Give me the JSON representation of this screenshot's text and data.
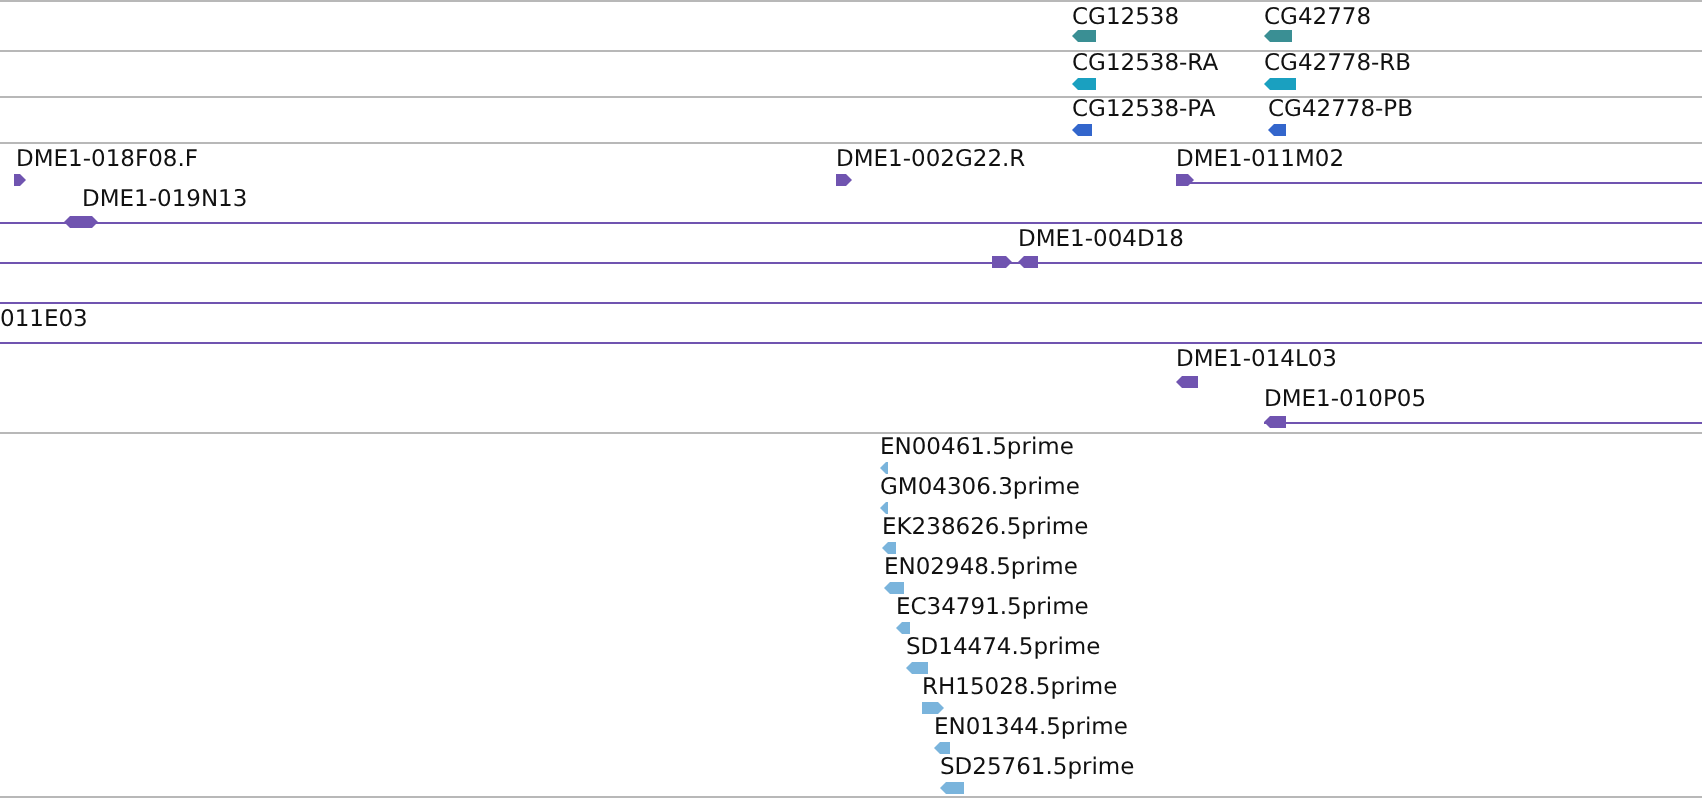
{
  "tracks": [
    {
      "features": [
        {
          "label": "CG12538",
          "kind": "reverse",
          "color": "#3a8f94"
        },
        {
          "label": "CG42778",
          "kind": "reverse",
          "color": "#3a8f94"
        }
      ]
    },
    {
      "features": [
        {
          "label": "CG12538-RA",
          "kind": "reverse",
          "color": "#1aa0c0"
        },
        {
          "label": "CG42778-RB",
          "kind": "reverse",
          "color": "#1aa0c0"
        }
      ]
    },
    {
      "features": [
        {
          "label": "CG12538-PA",
          "kind": "reverse",
          "color": "#3366cc"
        },
        {
          "label": "CG42778-PB",
          "kind": "reverse",
          "color": "#3366cc"
        }
      ]
    },
    {
      "features": [
        {
          "label": "DME1-018F08.F",
          "kind": "forward",
          "color": "#7054b0"
        },
        {
          "label": "DME1-019N13",
          "kind": "both",
          "color": "#7054b0"
        },
        {
          "label": "DME1-002G22.R",
          "kind": "forward",
          "color": "#7054b0"
        },
        {
          "label": "DME1-011M02",
          "kind": "forward",
          "color": "#7054b0"
        },
        {
          "label": "DME1-004D18",
          "kind": "pair",
          "color": "#7054b0"
        },
        {
          "label": "011E03",
          "kind": "line",
          "color": "#7054b0"
        },
        {
          "label": "DME1-014L03",
          "kind": "reverse",
          "color": "#7054b0"
        },
        {
          "label": "DME1-010P05",
          "kind": "reverse",
          "color": "#7054b0"
        }
      ]
    },
    {
      "features": [
        {
          "label": "EN00461.5prime",
          "kind": "reverse",
          "color": "#7ab4dc"
        },
        {
          "label": "GM04306.3prime",
          "kind": "reverse",
          "color": "#7ab4dc"
        },
        {
          "label": "EK238626.5prime",
          "kind": "reverse",
          "color": "#7ab4dc"
        },
        {
          "label": "EN02948.5prime",
          "kind": "reverse",
          "color": "#7ab4dc"
        },
        {
          "label": "EC34791.5prime",
          "kind": "reverse",
          "color": "#7ab4dc"
        },
        {
          "label": "SD14474.5prime",
          "kind": "reverse",
          "color": "#7ab4dc"
        },
        {
          "label": "RH15028.5prime",
          "kind": "forward",
          "color": "#7ab4dc"
        },
        {
          "label": "EN01344.5prime",
          "kind": "reverse",
          "color": "#7ab4dc"
        },
        {
          "label": "SD25761.5prime",
          "kind": "reverse",
          "color": "#7ab4dc"
        }
      ]
    }
  ]
}
